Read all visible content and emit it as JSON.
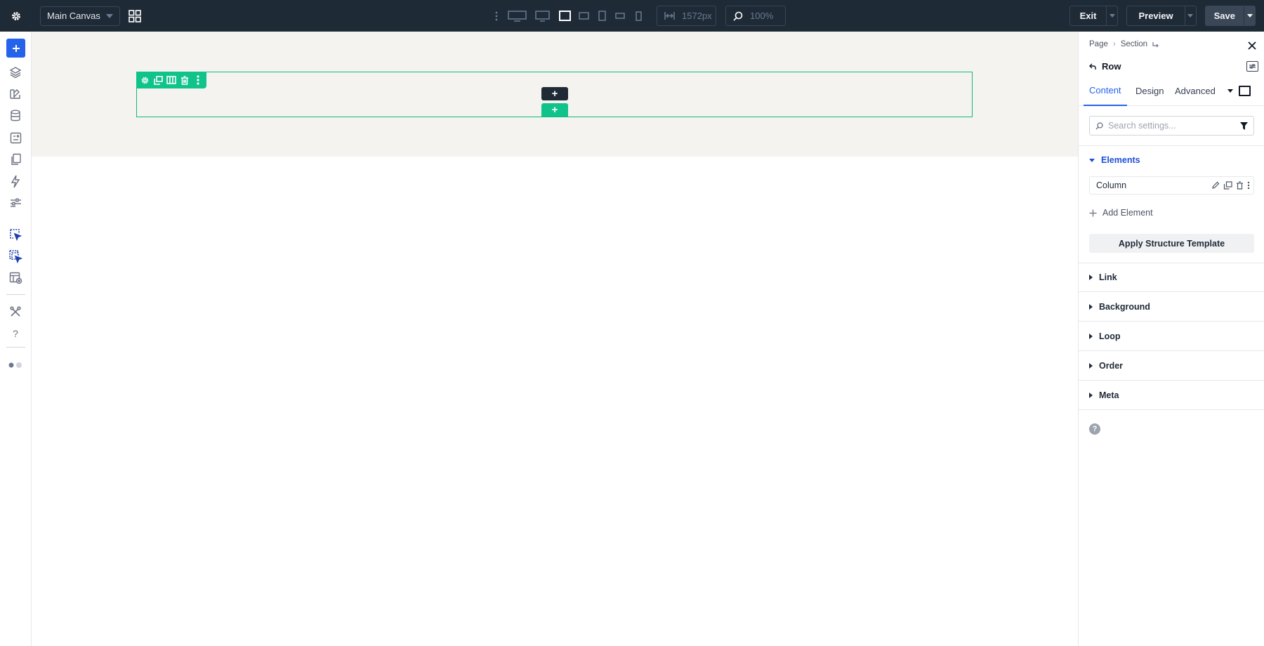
{
  "topbar": {
    "canvas_select": "Main Canvas",
    "width_value": "1572px",
    "zoom_value": "100%",
    "exit_label": "Exit",
    "preview_label": "Preview",
    "save_label": "Save"
  },
  "canvas": {
    "add_dark_symbol": "+",
    "add_green_symbol": "+"
  },
  "panel": {
    "breadcrumb": [
      "Page",
      "Section"
    ],
    "element_title": "Row",
    "tabs": [
      "Content",
      "Design",
      "Advanced"
    ],
    "search_placeholder": "Search settings...",
    "elements_group": "Elements",
    "column_item": "Column",
    "add_element_label": "Add Element",
    "apply_template_label": "Apply Structure Template",
    "groups": [
      "Link",
      "Background",
      "Loop",
      "Order",
      "Meta"
    ],
    "help_symbol": "?"
  },
  "leftbar": {
    "help_symbol": "?"
  },
  "colors": {
    "topbar_bg": "#1f2a37",
    "accent_blue": "#2563eb",
    "row_green": "#10c38a",
    "section_bg": "#f4f3ef"
  }
}
